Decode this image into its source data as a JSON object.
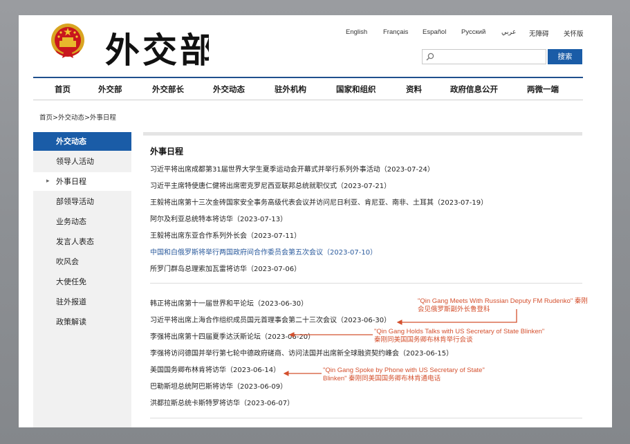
{
  "header": {
    "logo_text": "外交部",
    "languages": [
      "English",
      "Français",
      "Español",
      "Русский",
      "عربي",
      "无障碍",
      "关怀版"
    ],
    "search": {
      "placeholder": "",
      "button_label": "搜索"
    }
  },
  "nav": [
    "首页",
    "外交部",
    "外交部长",
    "外交动态",
    "驻外机构",
    "国家和组织",
    "资料",
    "政府信息公开",
    "两微一端"
  ],
  "breadcrumb": "首页>外交动态>外事日程",
  "sidebar": {
    "items": [
      "外交动态",
      "领导人活动",
      "外事日程",
      "部领导活动",
      "业务动态",
      "发言人表态",
      "吹风会",
      "大使任免",
      "驻外报道",
      "政策解读"
    ],
    "current_arrow": "▸"
  },
  "content": {
    "title": "外事日程",
    "group1": [
      "习近平将出席成都第31届世界大学生夏季运动会开幕式并举行系列外事活动（2023-07-24）",
      "习近平主席特使唐仁健将出席密克罗尼西亚联邦总统就职仪式（2023-07-21）",
      "王毅将出席第十三次金砖国家安全事务高级代表会议并访问尼日利亚、肯尼亚、南非、土耳其（2023-07-19）",
      "阿尔及利亚总统特本将访华（2023-07-13）",
      "王毅将出席东亚合作系列外长会（2023-07-11）",
      "中国和白俄罗斯将举行两国政府间合作委员会第五次会议（2023-07-10）",
      "所罗门群岛总理索加瓦雷将访华（2023-07-06）"
    ],
    "group2": [
      "韩正将出席第十一届世界和平论坛（2023-06-30）",
      "习近平将出席上海合作组织成员国元首理事会第二十三次会议（2023-06-30）",
      "李强将出席第十四届夏季达沃斯论坛（2023-06-20）",
      "李强将访问德国并举行第七轮中德政府磋商、访问法国并出席新全球融资契约峰会（2023-06-15）",
      "美国国务卿布林肯将访华（2023-06-14）",
      "巴勒斯坦总统阿巴斯将访华（2023-06-09）",
      "洪都拉斯总统卡斯特罗将访华（2023-06-07）"
    ]
  },
  "annotations": [
    {
      "line1": "\"Qin Gang Meets With Russian Deputy FM Rudenko\" 秦刚",
      "line2": "会见俄罗斯副外长鲁登科"
    },
    {
      "line1": "\"Qin Gang Holds Talks with US Secretary of State Blinken\"",
      "line2": "秦刚同美国国务卿布林肯举行会谈"
    },
    {
      "line1": "\"Qin Gang Spoke by Phone with US Secretary of State\"",
      "line2": "Blinken\" 秦刚同美国国务卿布林肯通电话"
    }
  ],
  "colors": {
    "accent": "#1a5ca7",
    "annotation": "#d4502e",
    "link": "#2a5a9c"
  }
}
